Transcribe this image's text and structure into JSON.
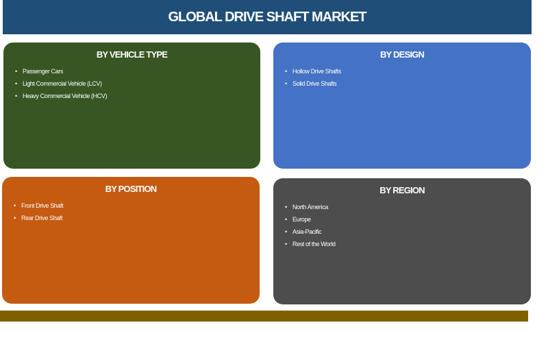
{
  "header": {
    "title": "GLOBAL DRIVE SHAFT MARKET"
  },
  "segments": [
    {
      "title": "BY VEHICLE TYPE",
      "items": [
        "Passenger Cars",
        "Light Commercial Vehicle (LCV)",
        "Heavy Commercial Vehicle (HCV)"
      ]
    },
    {
      "title": "BY DESIGN",
      "items": [
        "Hollow Drive Shafts",
        "Solid Drive Shafts"
      ]
    },
    {
      "title": "BY POSITION",
      "items": [
        "Front Drive Shaft",
        "Rear Drive Shaft"
      ]
    },
    {
      "title": "BY REGION",
      "items": [
        "North America",
        "Europe",
        "Asia-Pacific",
        "Rest of the World"
      ]
    }
  ],
  "colors": {
    "header": "#1f4e79",
    "vehicle": "#375623",
    "design": "#4472c4",
    "position": "#c55a11",
    "region": "#4d4d4d",
    "footer": "#7f6000"
  }
}
